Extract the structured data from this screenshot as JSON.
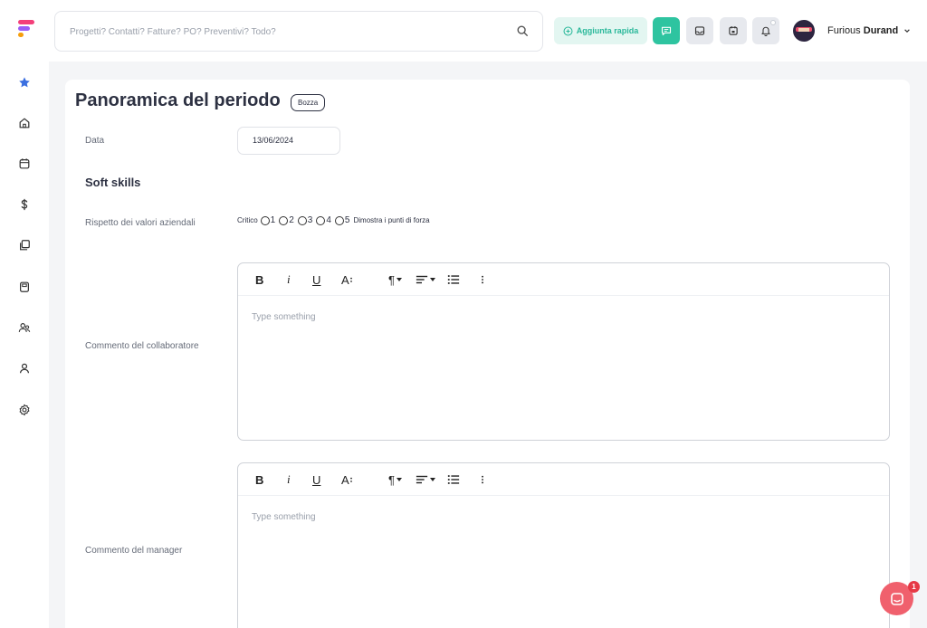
{
  "header": {
    "search_placeholder": "Progetti? Contatti? Fatture? PO? Preventivi? Todo?",
    "quick_add_label": "Aggiunta rapida",
    "user": {
      "first_name": "Furious",
      "last_name": "Durand"
    }
  },
  "sidebar": {
    "items": [
      {
        "icon": "star-icon",
        "active": true
      },
      {
        "icon": "home-icon"
      },
      {
        "icon": "calendar-icon"
      },
      {
        "icon": "dollar-icon"
      },
      {
        "icon": "documents-icon"
      },
      {
        "icon": "clipboard-icon"
      },
      {
        "icon": "users-icon"
      },
      {
        "icon": "user-icon"
      },
      {
        "icon": "settings-icon"
      }
    ]
  },
  "main": {
    "title": "Panoramica del periodo",
    "status_badge": "Bozza",
    "date": {
      "label": "Data",
      "value": "13/06/2024"
    },
    "section_title": "Soft skills",
    "rating": {
      "label": "Rispetto dei valori aziendali",
      "min_label": "Critico",
      "max_label": "Dimostra i punti di forza",
      "options": [
        "1",
        "2",
        "3",
        "4",
        "5"
      ]
    },
    "collaborator_comment": {
      "label": "Commento del collaboratore",
      "placeholder": "Type something"
    },
    "manager_comment": {
      "label": "Commento del manager",
      "placeholder": "Type something"
    },
    "editor_tools": {
      "bold": "B",
      "italic": "i",
      "underline": "U",
      "font_size": "A",
      "paragraph": "¶"
    }
  },
  "chat": {
    "unread_count": "1"
  },
  "colors": {
    "accent": "#2ec4a0",
    "chat": "#f0606d",
    "badge_red": "#e63946"
  }
}
